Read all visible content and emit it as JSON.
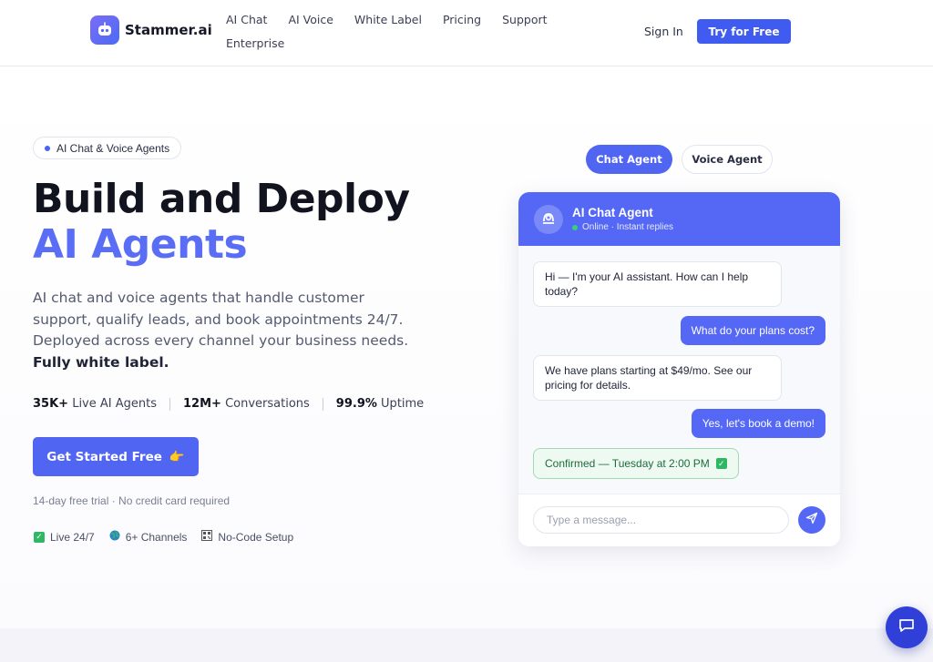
{
  "header": {
    "brand": "Stammer.ai",
    "nav": [
      "AI Chat",
      "AI Voice",
      "White Label",
      "Pricing",
      "Support",
      "Enterprise"
    ],
    "sign_in": "Sign In",
    "try_free": "Try for Free"
  },
  "hero": {
    "pill": "AI Chat & Voice Agents",
    "title_line1": "Build and Deploy",
    "title_line2": "AI Agents",
    "lead_text": "AI chat and voice agents that handle customer support, qualify leads, and book appointments 24/7. Deployed across every channel your business needs.",
    "lead_bold": "Fully white label.",
    "stats": [
      {
        "value": "35K+",
        "label": "Live AI Agents"
      },
      {
        "value": "12M+",
        "label": "Conversations"
      },
      {
        "value": "99.9%",
        "label": "Uptime"
      }
    ],
    "cta": "Get Started Free",
    "cta_emoji": "👉",
    "trial": "14-day free trial · No credit card required",
    "features": [
      {
        "icon": "check-box-icon",
        "label": "Live 24/7"
      },
      {
        "icon": "globe-icon",
        "label": "6+ Channels"
      },
      {
        "icon": "qr-icon",
        "label": "No-Code Setup"
      }
    ]
  },
  "demo": {
    "tabs": [
      "Chat Agent",
      "Voice Agent"
    ],
    "active_tab": "Chat Agent",
    "agent_name": "AI Chat Agent",
    "agent_status": "Online · Instant replies",
    "messages": [
      {
        "from": "bot",
        "text": "Hi — I'm your AI assistant. How can I help today?"
      },
      {
        "from": "user",
        "text": "What do your plans cost?"
      },
      {
        "from": "bot",
        "text": "We have plans starting at $49/mo. See our pricing for details."
      },
      {
        "from": "user",
        "text": "Yes, let's book a demo!"
      },
      {
        "from": "confirm",
        "text": "Confirmed — Tuesday at 2:00 PM"
      }
    ],
    "input_placeholder": "Type a message..."
  },
  "colors": {
    "primary": "#5468f5",
    "accent_text": "#5a6ef5",
    "success": "#35d07a",
    "launcher": "#2f3fd8"
  }
}
